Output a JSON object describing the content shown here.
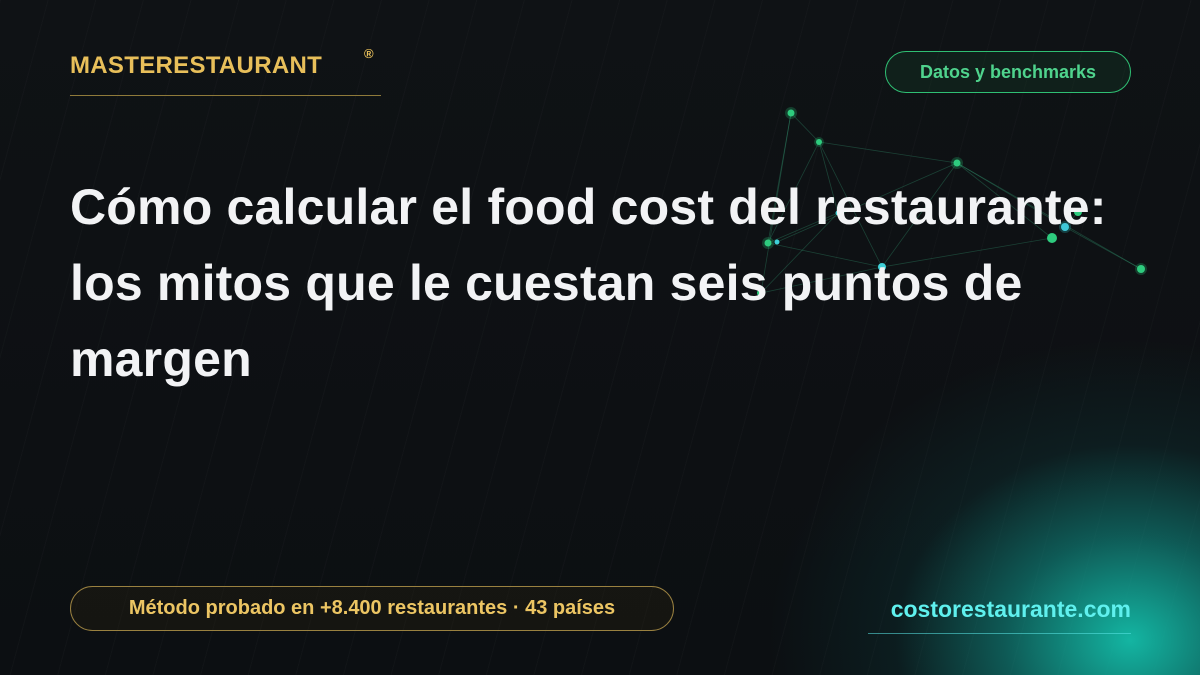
{
  "brand": {
    "name": "MASTERESTAURANT",
    "registered_mark": "®"
  },
  "category_badge": "Datos y benchmarks",
  "headline": "Cómo calcular el food cost del restaurante: los mitos que le cuestan seis puntos de margen",
  "proof_badge": "Método probado en +8.400 restaurantes · 43 países",
  "website": "costorestaurante.com",
  "colors": {
    "background": "#0d1013",
    "brand_gold": "#e8bf5a",
    "badge_green": "#4fd38d",
    "headline_white": "#f2f3f5",
    "url_cyan": "#5ff0ee",
    "glow_teal": "#14beaa"
  }
}
